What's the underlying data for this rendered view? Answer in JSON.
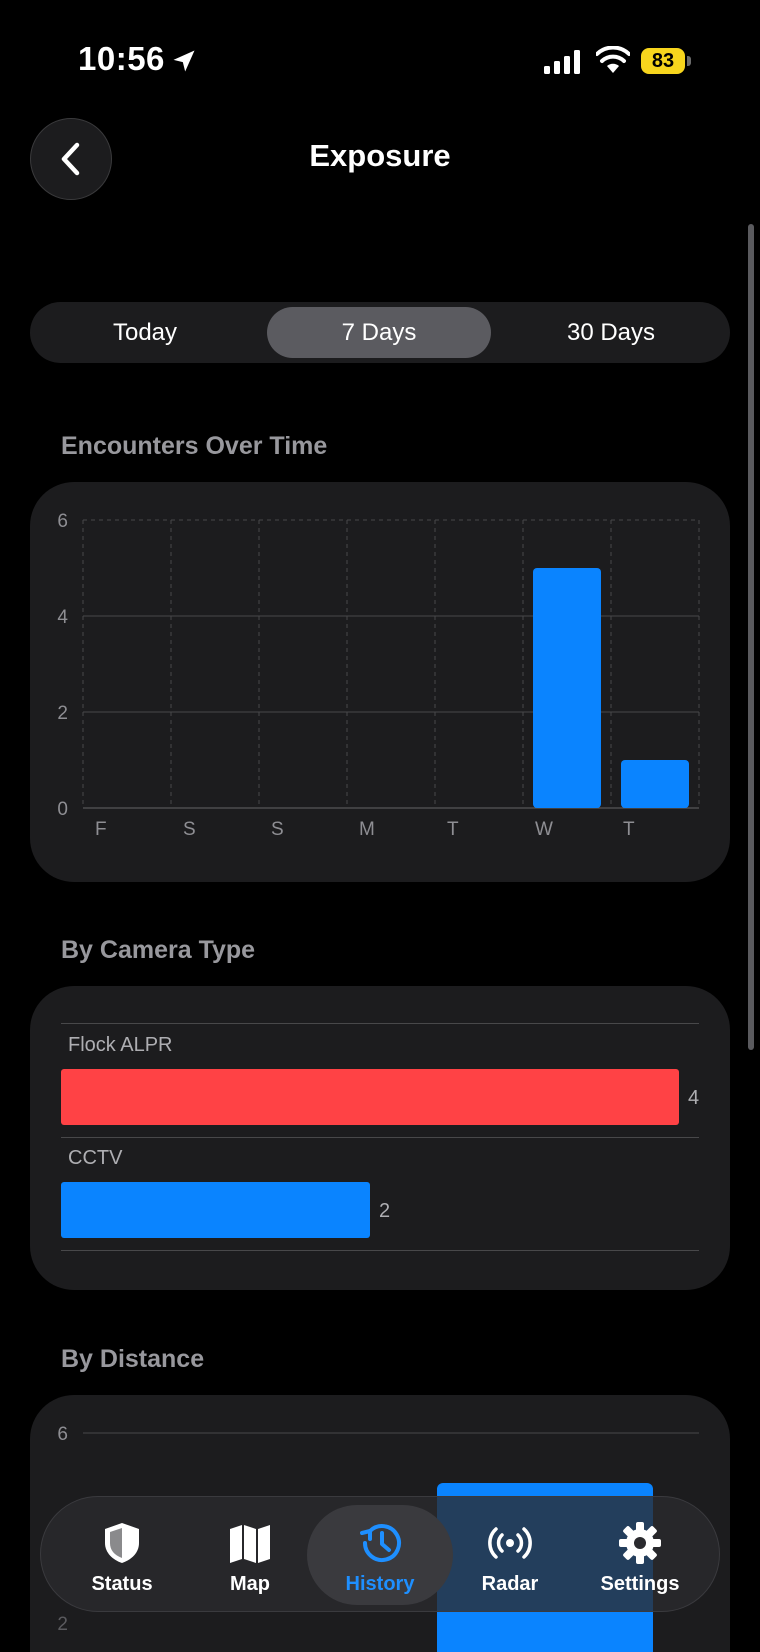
{
  "status_bar": {
    "time": "10:56",
    "battery": "83"
  },
  "header": {
    "title": "Exposure"
  },
  "segments": {
    "items": [
      {
        "label": "Today",
        "active": false
      },
      {
        "label": "7 Days",
        "active": true
      },
      {
        "label": "30 Days",
        "active": false
      }
    ]
  },
  "encounters": {
    "title": "Encounters Over Time",
    "chart_data": {
      "type": "bar",
      "categories": [
        "F",
        "S",
        "S",
        "M",
        "T",
        "W",
        "T"
      ],
      "values": [
        0,
        0,
        0,
        0,
        0,
        5,
        1
      ],
      "y_ticks": [
        "6",
        "4",
        "2",
        "0"
      ],
      "ylim": [
        0,
        6
      ],
      "color": "#0a84ff"
    }
  },
  "camera_type": {
    "title": "By Camera Type",
    "chart_data": {
      "type": "bar",
      "categories": [
        "Flock ALPR",
        "CCTV"
      ],
      "values": [
        4,
        2
      ],
      "value_labels": [
        "4",
        "2"
      ],
      "colors": [
        "#ff4245",
        "#0a84ff"
      ]
    }
  },
  "distance": {
    "title": "By Distance",
    "chart_data": {
      "type": "bar",
      "y_ticks_visible": [
        "6",
        "2"
      ],
      "ylim": [
        0,
        6
      ],
      "color": "#0a84ff"
    }
  },
  "tabbar": {
    "items": [
      {
        "label": "Status",
        "icon": "shield-icon",
        "active": false
      },
      {
        "label": "Map",
        "icon": "map-icon",
        "active": false
      },
      {
        "label": "History",
        "icon": "history-clock-icon",
        "active": true
      },
      {
        "label": "Radar",
        "icon": "radar-antenna-icon",
        "active": false
      },
      {
        "label": "Settings",
        "icon": "gear-icon",
        "active": false
      }
    ],
    "active_color": "#1e8fff"
  }
}
